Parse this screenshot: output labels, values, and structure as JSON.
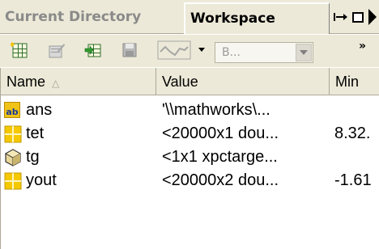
{
  "tabs": {
    "current_directory": "Current Directory",
    "workspace": "Workspace"
  },
  "window_controls": {
    "undock_icon": "undock-icon",
    "maximize_icon": "maximize-icon",
    "next_icon": "next-arrow-icon"
  },
  "toolbar": {
    "buttons": [
      "new-variable-icon",
      "open-selection-icon",
      "import-data-icon",
      "save-workspace-icon",
      "plot-icon"
    ],
    "select_value": "B...",
    "more_label": "»"
  },
  "table": {
    "columns": {
      "name": "Name",
      "name_sort_indicator": "△",
      "value": "Value",
      "min": "Min"
    },
    "rows": [
      {
        "icon": "char-array-icon",
        "name": "ans",
        "value": "'\\\\mathworks\\...",
        "min": ""
      },
      {
        "icon": "numeric-array-icon",
        "name": "tet",
        "value": "<20000x1 dou...",
        "min": "8.32."
      },
      {
        "icon": "object-icon",
        "name": "tg",
        "value": "<1x1 xpctarge...",
        "min": ""
      },
      {
        "icon": "numeric-array-icon",
        "name": "yout",
        "value": "<20000x2 dou...",
        "min": "-1.61"
      }
    ]
  }
}
